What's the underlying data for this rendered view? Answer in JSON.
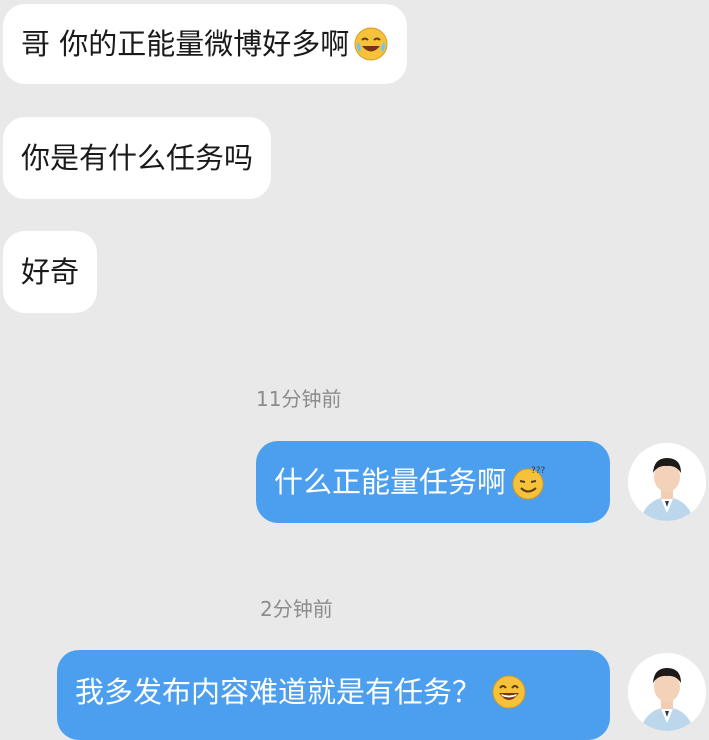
{
  "conversation": {
    "incoming": [
      {
        "text": "哥 你的正能量微博好多啊",
        "emoji": "crying-laughing-emoji"
      },
      {
        "text": "你是有什么任务吗"
      },
      {
        "text": "好奇"
      }
    ],
    "timestamps": [
      "11分钟前",
      "2分钟前"
    ],
    "outgoing": [
      {
        "text": "什么正能量任务啊",
        "emoji": "confused-smile-emoji"
      },
      {
        "text": "我多发布内容难道就是有任务？",
        "emoji": "laughing-emoji"
      }
    ]
  },
  "colors": {
    "background": "#e9e9e9",
    "incoming_bubble": "#ffffff",
    "outgoing_bubble": "#4c9fee",
    "timestamp_text": "#8c8c8c"
  }
}
